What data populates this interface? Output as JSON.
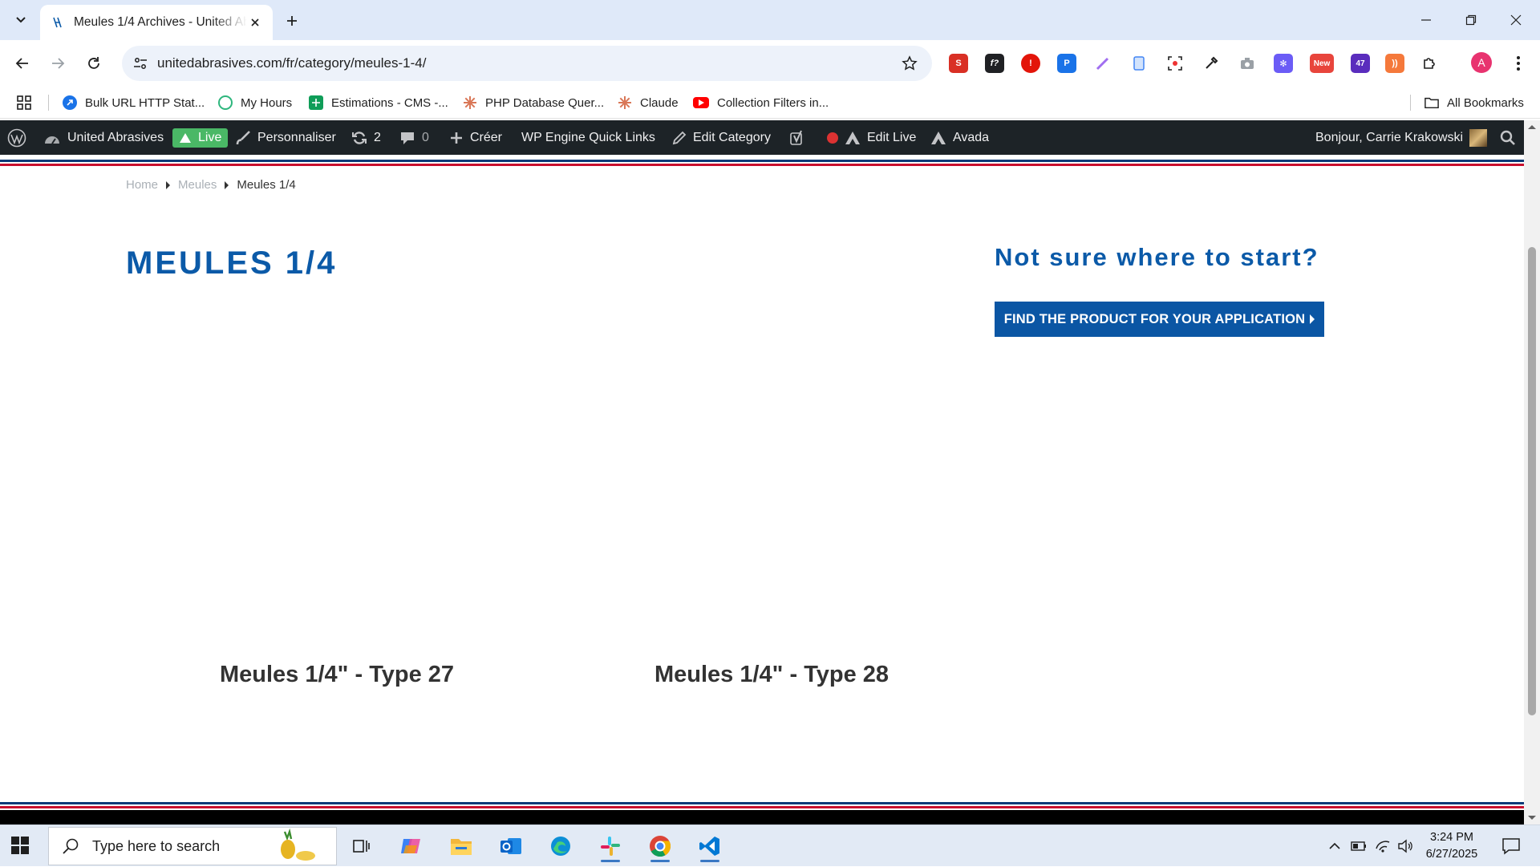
{
  "browser": {
    "tab_title": "Meules 1/4 Archives - United Abrasives",
    "url": "unitedabrasives.com/fr/category/meules-1-4/",
    "extension_badges": {
      "new": "New",
      "count": "47"
    },
    "profile_initial": "A"
  },
  "bookmarks": {
    "items": [
      {
        "label": "Bulk URL HTTP Stat..."
      },
      {
        "label": "My Hours"
      },
      {
        "label": "Estimations - CMS -..."
      },
      {
        "label": "PHP Database Quer..."
      },
      {
        "label": "Claude"
      },
      {
        "label": "Collection Filters in..."
      }
    ],
    "all_bookmarks": "All Bookmarks"
  },
  "wp_admin_bar": {
    "site_name": "United Abrasives",
    "live": "Live",
    "customize": "Personnaliser",
    "updates": "2",
    "comments": "0",
    "new": "Créer",
    "wp_engine": "WP Engine Quick Links",
    "edit_category": "Edit Category",
    "edit_live": "Edit Live",
    "avada": "Avada",
    "greeting": "Bonjour, Carrie Krakowski"
  },
  "page": {
    "breadcrumb": [
      "Home",
      "Meules",
      "Meules 1/4"
    ],
    "title": "MEULES 1/4",
    "cta_heading": "Not sure where to start?",
    "cta_button": "FIND THE PRODUCT FOR YOUR APPLICATION",
    "products": [
      "Meules 1/4\" - Type 27",
      "Meules 1/4\" - Type 28"
    ]
  },
  "colors": {
    "brand_blue": "#0b5aa8",
    "brand_red": "#c8102e",
    "admin_bar": "#1d2327",
    "live_green": "#4ab866"
  },
  "taskbar": {
    "search_placeholder": "Type here to search",
    "time": "3:24 PM",
    "date": "6/27/2025"
  }
}
